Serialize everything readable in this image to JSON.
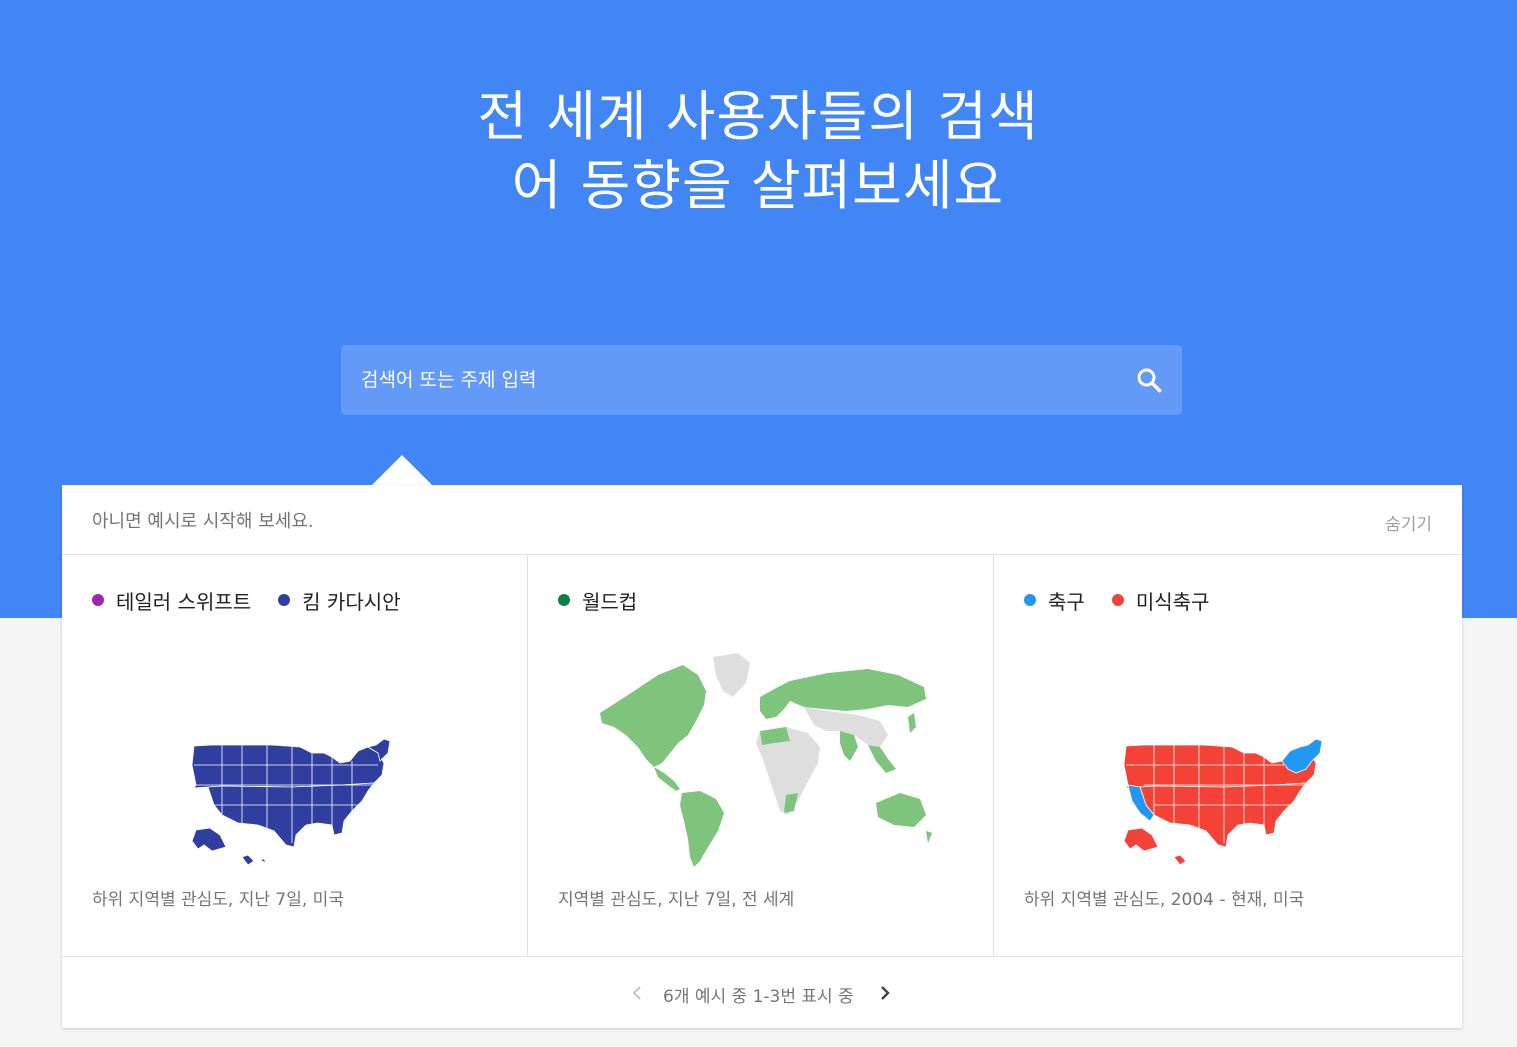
{
  "hero": {
    "headline": "전 세계 사용자들의 검색어 동향을 살펴보세요",
    "background_color": "#4285f4"
  },
  "search": {
    "placeholder": "검색어 또는 주제 입력",
    "icon": "search-icon"
  },
  "examples_panel": {
    "intro": "아니면 예시로 시작해 보세요.",
    "hide_label": "숨기기",
    "items": [
      {
        "terms": [
          {
            "label": "테일러 스위프트",
            "color": "#9c27b0"
          },
          {
            "label": "킴 카다시안",
            "color": "#303f9f"
          }
        ],
        "map": "us-map",
        "caption": "하위 지역별 관심도, 지난 7일, 미국"
      },
      {
        "terms": [
          {
            "label": "월드컵",
            "color": "#0b8043"
          }
        ],
        "map": "world-map",
        "caption": "지역별 관심도, 지난 7일, 전 세계"
      },
      {
        "terms": [
          {
            "label": "축구",
            "color": "#2196f3"
          },
          {
            "label": "미식축구",
            "color": "#f44336"
          }
        ],
        "map": "us-map",
        "caption": "하위 지역별 관심도, 2004 - 현재, 미국"
      }
    ],
    "pager": {
      "text": "6개 예시 중 1-3번 표시 중",
      "prev_icon": "chevron-left-icon",
      "next_icon": "chevron-right-icon"
    }
  }
}
